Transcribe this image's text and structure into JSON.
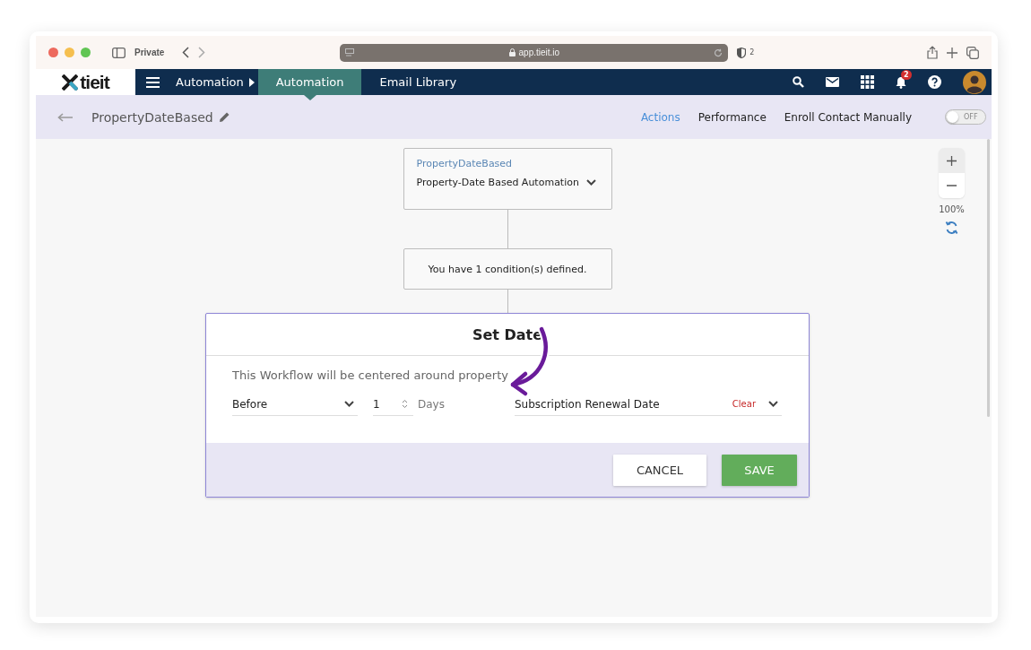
{
  "browser": {
    "private_label": "Private",
    "url": "app.tieit.io",
    "shield_count": "2"
  },
  "nav": {
    "logo": "tieit",
    "items": [
      {
        "label": "Automation",
        "kind": "breadcrumb"
      },
      {
        "label": "Automation",
        "kind": "tab",
        "selected": true
      },
      {
        "label": "Email Library",
        "kind": "tab",
        "selected": false
      }
    ],
    "notification_count": "2"
  },
  "header": {
    "title": "PropertyDateBased",
    "tabs": [
      {
        "label": "Actions",
        "selected": true
      },
      {
        "label": "Performance",
        "selected": false
      },
      {
        "label": "Enroll Contact Manually",
        "selected": false
      }
    ],
    "toggle": {
      "label": "OFF",
      "on": false
    }
  },
  "flow": {
    "trigger": {
      "label": "PropertyDateBased",
      "value": "Property-Date Based Automation"
    },
    "conditions": {
      "text": "You have 1 condition(s) defined."
    }
  },
  "zoom": {
    "level": "100%"
  },
  "modal": {
    "title": "Set Date",
    "description": "This Workflow will be centered around property",
    "timing": {
      "value": "Before"
    },
    "amount": {
      "value": "1"
    },
    "unit": "Days",
    "property": {
      "value": "Subscription Renewal Date"
    },
    "clear": "Clear",
    "buttons": [
      {
        "label": "CANCEL",
        "kind": "secondary"
      },
      {
        "label": "SAVE",
        "kind": "primary"
      }
    ]
  }
}
